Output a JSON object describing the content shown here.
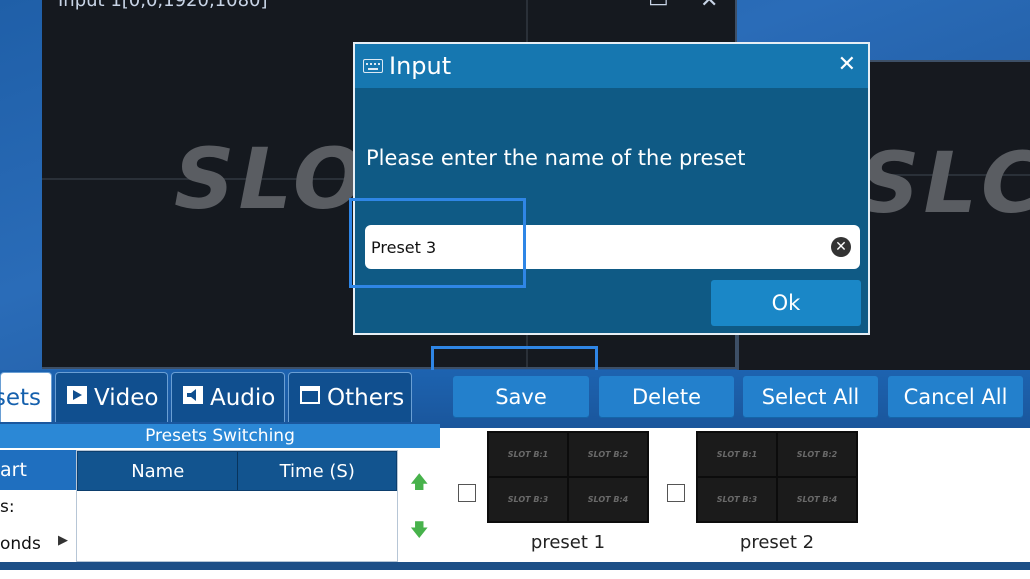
{
  "preview": {
    "title_fragment": "Input 1[0,0,1920,1080]",
    "slot_text_left": "SLO",
    "slot_text_right": "SLC"
  },
  "modal": {
    "title": "Input",
    "close_glyph": "✕",
    "prompt": "Please enter the name of the preset",
    "input_value": "Preset 3",
    "clear_glyph": "✕",
    "ok_label": "Ok"
  },
  "tabs": [
    {
      "label": "sets",
      "icon": "presets-icon"
    },
    {
      "label": "Video",
      "icon": "play-icon"
    },
    {
      "label": "Audio",
      "icon": "speaker-icon"
    },
    {
      "label": "Others",
      "icon": "window-icon"
    }
  ],
  "toolbar": {
    "save_label": "Save",
    "delete_label": "Delete",
    "select_all_label": "Select All",
    "cancel_all_label": "Cancel All"
  },
  "left_panel": {
    "header": "Presets Switching",
    "stub_label": "art",
    "line_1": "s:",
    "line_2": "onds",
    "table_columns": [
      "Name",
      "Time (S)"
    ]
  },
  "presets": [
    {
      "label": "preset 1",
      "cells": [
        "SLOT B:1",
        "SLOT B:2",
        "SLOT B:3",
        "SLOT B:4"
      ]
    },
    {
      "label": "preset 2",
      "cells": [
        "SLOT B:1",
        "SLOT B:2",
        "SLOT B:3",
        "SLOT B:4"
      ]
    }
  ],
  "colors": {
    "modal_bg": "#0f5a85",
    "modal_header": "#1677b0",
    "highlight": "#2f86e6",
    "toolbar_button": "#2380cc",
    "arrow_green": "#47b24b"
  }
}
